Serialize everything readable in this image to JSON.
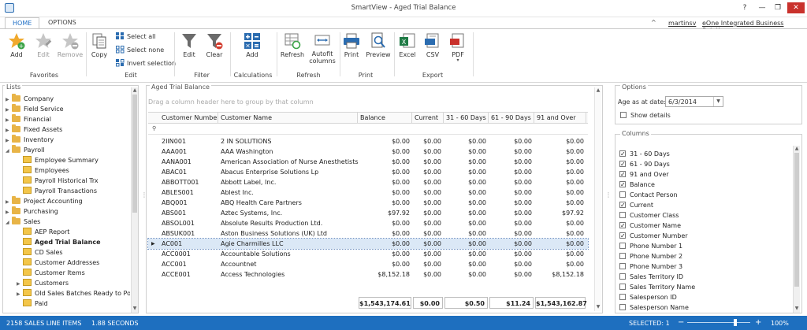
{
  "window": {
    "title": "SmartView - Aged Trial Balance",
    "help": "?",
    "restore": "❐",
    "minimize": "—",
    "close": "✕"
  },
  "tabs": [
    "HOME",
    "OPTIONS"
  ],
  "account": {
    "caret": "^",
    "user": "martinsv",
    "company": "eOne Integrated Business Solutions"
  },
  "ribbon": {
    "favorites": {
      "add": "Add",
      "edit": "Edit",
      "remove": "Remove",
      "group": "Favorites"
    },
    "edit": {
      "copy": "Copy",
      "select_all": "Select all",
      "select_none": "Select none",
      "invert": "Invert selection",
      "group": "Edit"
    },
    "filter": {
      "edit": "Edit",
      "clear": "Clear",
      "group": "Filter"
    },
    "calculations": {
      "add": "Add",
      "group": "Calculations"
    },
    "refresh": {
      "refresh": "Refresh",
      "autofit1": "Autofit",
      "autofit2": "columns",
      "group": "Refresh"
    },
    "print": {
      "print": "Print",
      "preview": "Preview",
      "group": "Print"
    },
    "export": {
      "excel": "Excel",
      "csv": "CSV",
      "pdf": "PDF",
      "group": "Export"
    }
  },
  "lists": {
    "title": "Lists",
    "items": [
      {
        "label": "Company",
        "type": "folder",
        "level": 0,
        "bold": false
      },
      {
        "label": "Field Service",
        "type": "folder",
        "level": 0,
        "bold": false
      },
      {
        "label": "Financial",
        "type": "folder",
        "level": 0,
        "bold": false
      },
      {
        "label": "Fixed Assets",
        "type": "folder",
        "level": 0,
        "bold": false
      },
      {
        "label": "Inventory",
        "type": "folder",
        "level": 0,
        "bold": false
      },
      {
        "label": "Payroll",
        "type": "folder",
        "level": 0,
        "bold": false,
        "expanded": true
      },
      {
        "label": "Employee Summary",
        "type": "doc",
        "level": 1,
        "bold": false
      },
      {
        "label": "Employees",
        "type": "doc",
        "level": 1,
        "bold": false
      },
      {
        "label": "Payroll Historical Trx",
        "type": "doc",
        "level": 1,
        "bold": false
      },
      {
        "label": "Payroll Transactions",
        "type": "doc",
        "level": 1,
        "bold": false
      },
      {
        "label": "Project Accounting",
        "type": "folder",
        "level": 0,
        "bold": false
      },
      {
        "label": "Purchasing",
        "type": "folder",
        "level": 0,
        "bold": false
      },
      {
        "label": "Sales",
        "type": "folder",
        "level": 0,
        "bold": false,
        "expanded": true
      },
      {
        "label": "AEP Report",
        "type": "doc",
        "level": 1,
        "bold": false
      },
      {
        "label": "Aged Trial Balance",
        "type": "doc",
        "level": 1,
        "bold": true
      },
      {
        "label": "CD Sales",
        "type": "doc",
        "level": 1,
        "bold": false
      },
      {
        "label": "Customer Addresses",
        "type": "doc",
        "level": 1,
        "bold": false
      },
      {
        "label": "Customer Items",
        "type": "doc",
        "level": 1,
        "bold": false
      },
      {
        "label": "Customers",
        "type": "doc",
        "level": 1,
        "bold": false,
        "child": true
      },
      {
        "label": "Old Sales Batches Ready to Post",
        "type": "doc",
        "level": 1,
        "bold": false,
        "child": true
      },
      {
        "label": "Paid",
        "type": "doc",
        "level": 1,
        "bold": false
      }
    ]
  },
  "grid": {
    "title": "Aged Trial Balance",
    "group_hint": "Drag a column header here to group by that column",
    "filter_icon": "⚲",
    "columns": [
      "Customer Number",
      "Customer Name",
      "Balance",
      "Current",
      "31 - 60 Days",
      "61 - 90 Days",
      "91 and Over"
    ],
    "rows": [
      [
        "2IIN001",
        "2 IN SOLUTIONS",
        "$0.00",
        "$0.00",
        "$0.00",
        "$0.00",
        "$0.00"
      ],
      [
        "AAA001",
        "AAA Washington",
        "$0.00",
        "$0.00",
        "$0.00",
        "$0.00",
        "$0.00"
      ],
      [
        "AANA001",
        "American Association of Nurse Anesthetists",
        "$0.00",
        "$0.00",
        "$0.00",
        "$0.00",
        "$0.00"
      ],
      [
        "ABAC01",
        "Abacus Enterprise Solutions Lp",
        "$0.00",
        "$0.00",
        "$0.00",
        "$0.00",
        "$0.00"
      ],
      [
        "ABBOTT001",
        "Abbott Label, Inc.",
        "$0.00",
        "$0.00",
        "$0.00",
        "$0.00",
        "$0.00"
      ],
      [
        "ABLES001",
        "Ablest Inc.",
        "$0.00",
        "$0.00",
        "$0.00",
        "$0.00",
        "$0.00"
      ],
      [
        "ABQ001",
        "ABQ Health Care Partners",
        "$0.00",
        "$0.00",
        "$0.00",
        "$0.00",
        "$0.00"
      ],
      [
        "ABS001",
        "Aztec Systems, Inc.",
        "$97.92",
        "$0.00",
        "$0.00",
        "$0.00",
        "$97.92"
      ],
      [
        "ABSOL001",
        "Absolute Results Production Ltd.",
        "$0.00",
        "$0.00",
        "$0.00",
        "$0.00",
        "$0.00"
      ],
      [
        "ABSUK001",
        "Aston Business Solutions (UK) Ltd",
        "$0.00",
        "$0.00",
        "$0.00",
        "$0.00",
        "$0.00"
      ],
      [
        "AC001",
        "Agie Charmilles LLC",
        "$0.00",
        "$0.00",
        "$0.00",
        "$0.00",
        "$0.00"
      ],
      [
        "ACC0001",
        "Accountable Solutions",
        "$0.00",
        "$0.00",
        "$0.00",
        "$0.00",
        "$0.00"
      ],
      [
        "ACC001",
        "Accountnet",
        "$0.00",
        "$0.00",
        "$0.00",
        "$0.00",
        "$0.00"
      ],
      [
        "ACCE001",
        "Access Technologies",
        "$8,152.18",
        "$0.00",
        "$0.00",
        "$0.00",
        "$8,152.18"
      ]
    ],
    "selected_row": 10,
    "totals": [
      "$1,543,174.61",
      "$0.00",
      "$0.50",
      "$11.24",
      "$1,543,162.87"
    ]
  },
  "options": {
    "title": "Options",
    "age_label": "Age as at date:",
    "age_value": "6/3/2014",
    "show_details": "Show details"
  },
  "columns_panel": {
    "title": "Columns",
    "items": [
      {
        "label": "31 - 60 Days",
        "checked": true
      },
      {
        "label": "61 - 90 Days",
        "checked": true
      },
      {
        "label": "91 and Over",
        "checked": true
      },
      {
        "label": "Balance",
        "checked": true
      },
      {
        "label": "Contact Person",
        "checked": false
      },
      {
        "label": "Current",
        "checked": true
      },
      {
        "label": "Customer Class",
        "checked": false
      },
      {
        "label": "Customer Name",
        "checked": true
      },
      {
        "label": "Customer Number",
        "checked": true
      },
      {
        "label": "Phone Number 1",
        "checked": false
      },
      {
        "label": "Phone Number 2",
        "checked": false
      },
      {
        "label": "Phone Number 3",
        "checked": false
      },
      {
        "label": "Sales Territory ID",
        "checked": false
      },
      {
        "label": "Sales Territory Name",
        "checked": false
      },
      {
        "label": "Salesperson ID",
        "checked": false
      },
      {
        "label": "Salesperson Name",
        "checked": false
      }
    ]
  },
  "status": {
    "line_items": "2158 SALES LINE ITEMS",
    "seconds": "1.88 SECONDS",
    "selected": "SELECTED: 1",
    "zoom": "100%",
    "zoom_level": 0.76
  }
}
